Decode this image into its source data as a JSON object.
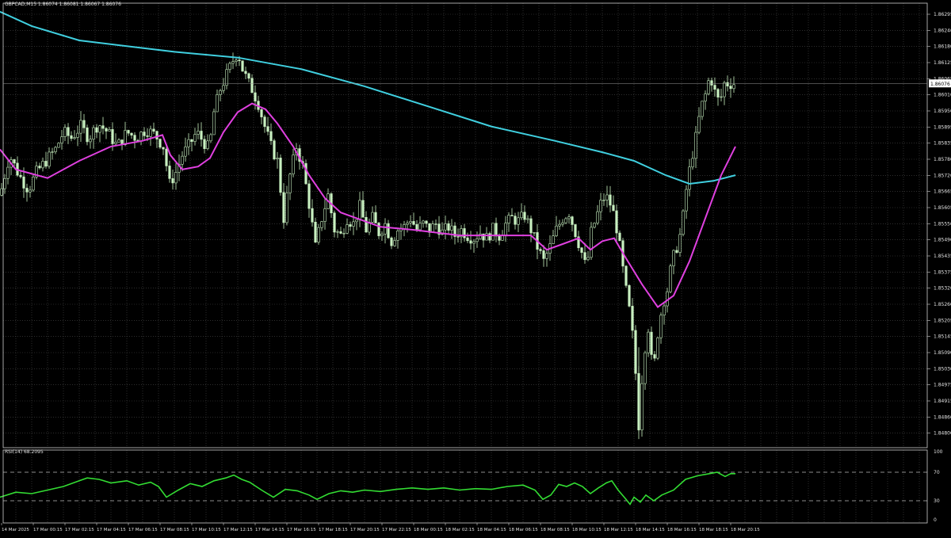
{
  "chart": {
    "header": "GBPCAD,M15  1.86074 1.86081 1.86067 1.86076",
    "current_price": "1.86076",
    "colors": {
      "background": "#000000",
      "grid": "#4a4a4a",
      "candle": "#c8f0c0",
      "ma_fast": "#e040e0",
      "ma_slow": "#40d0e0",
      "rsi": "#33dd33",
      "frame": "#cfcfcf"
    }
  },
  "rsi_panel": {
    "header": "RSI(14) 68.2095",
    "levels": [
      "100",
      "70",
      "30",
      "0"
    ]
  },
  "price_axis": {
    "labels": [
      "1.86295",
      "1.86240",
      "1.86180",
      "1.86125",
      "1.86065",
      "1.86010",
      "1.85950",
      "1.85895",
      "1.85835",
      "1.85780",
      "1.85720",
      "1.85665",
      "1.85605",
      "1.85550",
      "1.85490",
      "1.85435",
      "1.85375",
      "1.85320",
      "1.85260",
      "1.85205",
      "1.85145",
      "1.85090",
      "1.85030",
      "1.84975",
      "1.84915",
      "1.84860",
      "1.84800"
    ]
  },
  "time_axis": {
    "labels": [
      "14 Mar 2025",
      "17 Mar 00:15",
      "17 Mar 02:15",
      "17 Mar 04:15",
      "17 Mar 06:15",
      "17 Mar 08:15",
      "17 Mar 10:15",
      "17 Mar 12:15",
      "17 Mar 14:15",
      "17 Mar 16:15",
      "17 Mar 18:15",
      "17 Mar 20:15",
      "17 Mar 22:15",
      "18 Mar 00:15",
      "18 Mar 02:15",
      "18 Mar 04:15",
      "18 Mar 06:15",
      "18 Mar 08:15",
      "18 Mar 10:15",
      "18 Mar 12:15",
      "18 Mar 14:15",
      "18 Mar 16:15",
      "18 Mar 18:15",
      "18 Mar 20:15"
    ]
  },
  "chart_data": {
    "type": "candlestick",
    "symbol": "GBPCAD",
    "timeframe": "M15",
    "ylim": [
      1.848,
      1.863
    ],
    "close_path": [
      [
        0,
        1.8568
      ],
      [
        12,
        1.8582
      ],
      [
        24,
        1.8575
      ],
      [
        36,
        1.857
      ],
      [
        46,
        1.8576
      ],
      [
        58,
        1.858
      ],
      [
        70,
        1.8584
      ],
      [
        80,
        1.859
      ],
      [
        90,
        1.8588
      ],
      [
        102,
        1.8592
      ],
      [
        112,
        1.8588
      ],
      [
        124,
        1.8593
      ],
      [
        136,
        1.859
      ],
      [
        148,
        1.8585
      ],
      [
        160,
        1.859
      ],
      [
        172,
        1.8588
      ],
      [
        184,
        1.8591
      ],
      [
        196,
        1.8589
      ],
      [
        206,
        1.8585
      ],
      [
        214,
        1.8572
      ],
      [
        222,
        1.8576
      ],
      [
        230,
        1.8582
      ],
      [
        240,
        1.8586
      ],
      [
        248,
        1.859
      ],
      [
        256,
        1.8587
      ],
      [
        264,
        1.8584
      ],
      [
        270,
        1.8597
      ],
      [
        278,
        1.8605
      ],
      [
        286,
        1.861
      ],
      [
        294,
        1.8615
      ],
      [
        300,
        1.8618
      ],
      [
        306,
        1.8612
      ],
      [
        312,
        1.8608
      ],
      [
        318,
        1.8605
      ],
      [
        326,
        1.86
      ],
      [
        334,
        1.8592
      ],
      [
        342,
        1.8585
      ],
      [
        350,
        1.858
      ],
      [
        358,
        1.856
      ],
      [
        366,
        1.8575
      ],
      [
        374,
        1.8585
      ],
      [
        382,
        1.8578
      ],
      [
        390,
        1.8565
      ],
      [
        398,
        1.855
      ],
      [
        406,
        1.856
      ],
      [
        414,
        1.8568
      ],
      [
        422,
        1.8556
      ],
      [
        430,
        1.8554
      ],
      [
        438,
        1.856
      ],
      [
        446,
        1.8558
      ],
      [
        454,
        1.8564
      ],
      [
        462,
        1.8556
      ],
      [
        470,
        1.856
      ],
      [
        478,
        1.8555
      ],
      [
        486,
        1.8558
      ],
      [
        494,
        1.8552
      ],
      [
        502,
        1.8556
      ],
      [
        510,
        1.8557
      ],
      [
        518,
        1.856
      ],
      [
        526,
        1.8556
      ],
      [
        534,
        1.8558
      ],
      [
        542,
        1.8556
      ],
      [
        550,
        1.8558
      ],
      [
        558,
        1.8555
      ],
      [
        566,
        1.8557
      ],
      [
        574,
        1.8554
      ],
      [
        582,
        1.8556
      ],
      [
        590,
        1.8554
      ],
      [
        598,
        1.8553
      ],
      [
        606,
        1.8555
      ],
      [
        614,
        1.8553
      ],
      [
        622,
        1.8556
      ],
      [
        630,
        1.8554
      ],
      [
        638,
        1.8558
      ],
      [
        646,
        1.856
      ],
      [
        654,
        1.8559
      ],
      [
        662,
        1.8561
      ],
      [
        670,
        1.8556
      ],
      [
        678,
        1.855
      ],
      [
        686,
        1.8545
      ],
      [
        694,
        1.855
      ],
      [
        702,
        1.8556
      ],
      [
        710,
        1.856
      ],
      [
        718,
        1.8562
      ],
      [
        726,
        1.8555
      ],
      [
        734,
        1.8548
      ],
      [
        740,
        1.8542
      ],
      [
        746,
        1.8555
      ],
      [
        752,
        1.856
      ],
      [
        758,
        1.8565
      ],
      [
        764,
        1.8568
      ],
      [
        770,
        1.8565
      ],
      [
        776,
        1.856
      ],
      [
        782,
        1.855
      ],
      [
        788,
        1.8538
      ],
      [
        794,
        1.8528
      ],
      [
        800,
        1.8515
      ],
      [
        806,
        1.8488
      ],
      [
        812,
        1.8512
      ],
      [
        818,
        1.8522
      ],
      [
        824,
        1.8505
      ],
      [
        830,
        1.852
      ],
      [
        836,
        1.853
      ],
      [
        842,
        1.8535
      ],
      [
        848,
        1.8545
      ],
      [
        854,
        1.855
      ],
      [
        860,
        1.8556
      ],
      [
        866,
        1.857
      ],
      [
        872,
        1.858
      ],
      [
        878,
        1.8588
      ],
      [
        884,
        1.8598
      ],
      [
        890,
        1.8603
      ],
      [
        896,
        1.861
      ],
      [
        902,
        1.8604
      ],
      [
        908,
        1.86
      ],
      [
        914,
        1.8607
      ],
      [
        920,
        1.8607
      ],
      [
        926,
        1.8607
      ]
    ],
    "series": [
      {
        "values_path": [
          [
            0,
            1.8584
          ],
          [
            20,
            1.8577
          ],
          [
            60,
            1.8574
          ],
          [
            100,
            1.858
          ],
          [
            140,
            1.8585
          ],
          [
            180,
            1.8587
          ],
          [
            205,
            1.8589
          ],
          [
            215,
            1.8582
          ],
          [
            230,
            1.8577
          ],
          [
            250,
            1.8578
          ],
          [
            265,
            1.8581
          ],
          [
            282,
            1.859
          ],
          [
            300,
            1.8597
          ],
          [
            318,
            1.86
          ],
          [
            335,
            1.8598
          ],
          [
            350,
            1.8593
          ],
          [
            370,
            1.8585
          ],
          [
            390,
            1.8575
          ],
          [
            410,
            1.8567
          ],
          [
            430,
            1.8562
          ],
          [
            450,
            1.856
          ],
          [
            480,
            1.8557
          ],
          [
            520,
            1.8556
          ],
          [
            580,
            1.8554
          ],
          [
            640,
            1.8554
          ],
          [
            670,
            1.8554
          ],
          [
            690,
            1.8549
          ],
          [
            710,
            1.8551
          ],
          [
            730,
            1.8553
          ],
          [
            745,
            1.8549
          ],
          [
            760,
            1.8552
          ],
          [
            775,
            1.8553
          ],
          [
            790,
            1.8546
          ],
          [
            810,
            1.8537
          ],
          [
            830,
            1.8529
          ],
          [
            850,
            1.8533
          ],
          [
            870,
            1.8545
          ],
          [
            890,
            1.856
          ],
          [
            910,
            1.8575
          ],
          [
            928,
            1.8585
          ]
        ]
      },
      {
        "values_path": [
          [
            0,
            1.8632
          ],
          [
            40,
            1.8627
          ],
          [
            100,
            1.8622
          ],
          [
            160,
            1.862
          ],
          [
            220,
            1.8618
          ],
          [
            300,
            1.8616
          ],
          [
            380,
            1.8612
          ],
          [
            460,
            1.8606
          ],
          [
            540,
            1.8599
          ],
          [
            620,
            1.8592
          ],
          [
            700,
            1.8587
          ],
          [
            760,
            1.8583
          ],
          [
            800,
            1.858
          ],
          [
            840,
            1.8575
          ],
          [
            870,
            1.8572
          ],
          [
            900,
            1.8573
          ],
          [
            928,
            1.8575
          ]
        ]
      }
    ],
    "rsi": {
      "period": 14,
      "last": 68.2095,
      "ylim": [
        0,
        100
      ],
      "levels": [
        70,
        30
      ],
      "path": [
        [
          0,
          35
        ],
        [
          20,
          42
        ],
        [
          40,
          40
        ],
        [
          60,
          45
        ],
        [
          80,
          50
        ],
        [
          100,
          58
        ],
        [
          110,
          62
        ],
        [
          125,
          60
        ],
        [
          140,
          55
        ],
        [
          160,
          58
        ],
        [
          175,
          52
        ],
        [
          190,
          56
        ],
        [
          200,
          50
        ],
        [
          210,
          35
        ],
        [
          225,
          45
        ],
        [
          240,
          54
        ],
        [
          255,
          50
        ],
        [
          270,
          58
        ],
        [
          285,
          62
        ],
        [
          295,
          66
        ],
        [
          305,
          60
        ],
        [
          315,
          56
        ],
        [
          330,
          45
        ],
        [
          345,
          35
        ],
        [
          360,
          46
        ],
        [
          375,
          44
        ],
        [
          390,
          38
        ],
        [
          400,
          32
        ],
        [
          415,
          40
        ],
        [
          430,
          44
        ],
        [
          445,
          42
        ],
        [
          460,
          45
        ],
        [
          480,
          43
        ],
        [
          500,
          46
        ],
        [
          520,
          48
        ],
        [
          540,
          46
        ],
        [
          560,
          48
        ],
        [
          580,
          45
        ],
        [
          600,
          47
        ],
        [
          620,
          46
        ],
        [
          640,
          50
        ],
        [
          660,
          52
        ],
        [
          675,
          45
        ],
        [
          685,
          32
        ],
        [
          695,
          38
        ],
        [
          705,
          53
        ],
        [
          715,
          50
        ],
        [
          725,
          55
        ],
        [
          735,
          50
        ],
        [
          745,
          40
        ],
        [
          755,
          48
        ],
        [
          765,
          55
        ],
        [
          772,
          58
        ],
        [
          780,
          45
        ],
        [
          790,
          32
        ],
        [
          795,
          25
        ],
        [
          800,
          35
        ],
        [
          808,
          28
        ],
        [
          815,
          38
        ],
        [
          825,
          30
        ],
        [
          835,
          38
        ],
        [
          850,
          45
        ],
        [
          865,
          60
        ],
        [
          880,
          65
        ],
        [
          895,
          68
        ],
        [
          905,
          70
        ],
        [
          915,
          64
        ],
        [
          922,
          68
        ],
        [
          928,
          68
        ]
      ]
    }
  }
}
